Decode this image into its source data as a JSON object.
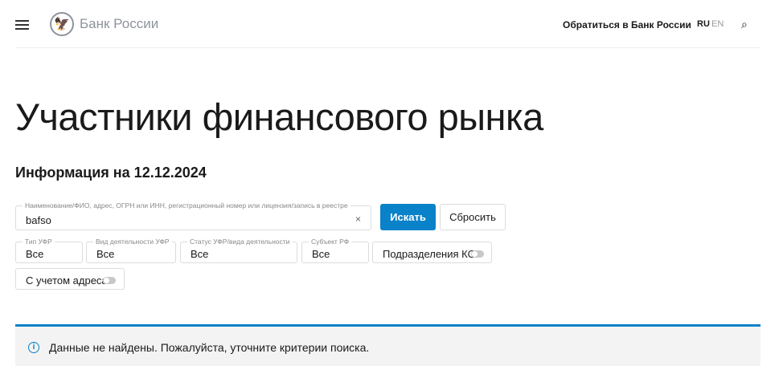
{
  "header": {
    "brand": "Банк России",
    "contact": "Обратиться в Банк России",
    "lang_ru": "RU",
    "lang_en": "EN"
  },
  "page": {
    "title": "Участники финансового рынка",
    "subtitle": "Информация на 12.12.2024"
  },
  "search": {
    "label": "Наименование/ФИО, адрес, ОГРН или ИНН, регистрационный номер или лицензия/запись в реестре",
    "value": "bafso",
    "clear": "×",
    "submit": "Искать",
    "reset": "Сбросить"
  },
  "filters": [
    {
      "label": "Тип УФР",
      "value": "Все"
    },
    {
      "label": "Вид деятельности УФР",
      "value": "Все"
    },
    {
      "label": "Статус УФР/вида деятельности",
      "value": "Все"
    },
    {
      "label": "Субъект РФ",
      "value": "Все"
    }
  ],
  "toggles": [
    {
      "label": "Подразделения КО",
      "on": false
    },
    {
      "label": "С учетом адреса",
      "on": false
    }
  ],
  "alert": {
    "icon": "info-icon",
    "text": "Данные не найдены. Пожалуйста, уточните критерии поиска."
  },
  "colors": {
    "accent": "#0a82c9"
  }
}
